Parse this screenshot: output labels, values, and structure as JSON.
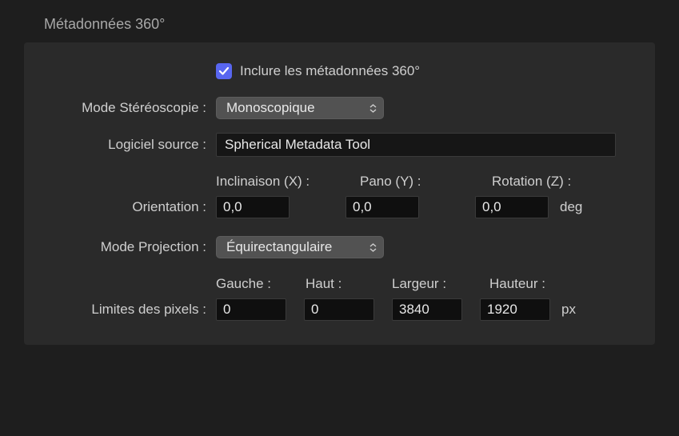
{
  "section_title": "Métadonnées 360°",
  "include": {
    "label": "Inclure les métadonnées 360°",
    "checked": true
  },
  "stereo": {
    "label": "Mode Stéréoscopie :",
    "value": "Monoscopique"
  },
  "source_software": {
    "label": "Logiciel source :",
    "value": "Spherical Metadata Tool"
  },
  "orientation": {
    "label": "Orientation :",
    "headers": {
      "tilt": "Inclinaison (X) :",
      "pan": "Pano (Y) :",
      "roll": "Rotation (Z) :"
    },
    "tilt": "0,0",
    "pan": "0,0",
    "roll": "0,0",
    "unit": "deg"
  },
  "projection": {
    "label": "Mode Projection :",
    "value": "Équirectangulaire"
  },
  "pixel_bounds": {
    "label": "Limites des pixels :",
    "headers": {
      "left": "Gauche :",
      "top": "Haut :",
      "width": "Largeur :",
      "height": "Hauteur :"
    },
    "left": "0",
    "top": "0",
    "width": "3840",
    "height": "1920",
    "unit": "px"
  }
}
